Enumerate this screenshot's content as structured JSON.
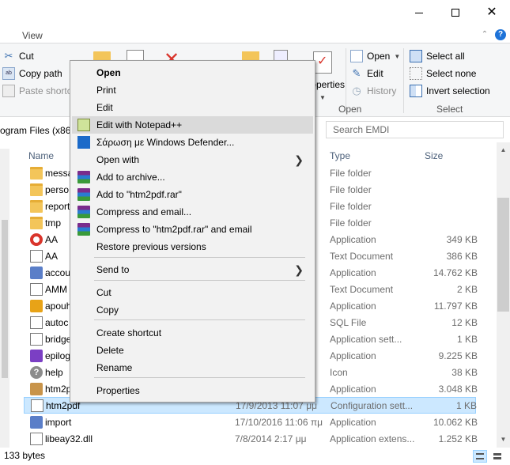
{
  "ribbon": {
    "tab_view": "View",
    "clipboard": {
      "cut": "Cut",
      "copy_path": "Copy path",
      "paste_shortcut": "Paste shortcut"
    },
    "properties_label": "Properties",
    "open_group": {
      "open": "Open",
      "edit": "Edit",
      "history": "History",
      "label": "Open"
    },
    "select_group": {
      "select_all": "Select all",
      "select_none": "Select none",
      "invert_selection": "Invert selection",
      "label": "Select"
    }
  },
  "address": {
    "path": "ogram Files (x86)",
    "search_placeholder": "Search EMDI"
  },
  "columns": {
    "name": "Name",
    "type": "Type",
    "size": "Size"
  },
  "files": [
    {
      "name": "messa",
      "date": "",
      "type": "File folder",
      "size": "",
      "icon": "folder-icon"
    },
    {
      "name": "perso",
      "date": "",
      "type": "File folder",
      "size": "",
      "icon": "folder-icon"
    },
    {
      "name": "report",
      "date": "",
      "type": "File folder",
      "size": "",
      "icon": "folder-icon"
    },
    {
      "name": "tmp",
      "date": "",
      "type": "File folder",
      "size": "",
      "icon": "folder-icon"
    },
    {
      "name": "AA",
      "date": "",
      "type": "Application",
      "size": "349 KB",
      "icon": "lifebuoy-icon"
    },
    {
      "name": "AA",
      "date": "",
      "type": "Text Document",
      "size": "386 KB",
      "icon": "text-document-icon"
    },
    {
      "name": "accou",
      "date": "",
      "type": "Application",
      "size": "14.762 KB",
      "icon": "application-icon"
    },
    {
      "name": "AMM",
      "date": "",
      "type": "Text Document",
      "size": "2 KB",
      "icon": "text-document-icon"
    },
    {
      "name": "apouh",
      "date": "",
      "type": "Application",
      "size": "11.797 KB",
      "icon": "gold-app-icon"
    },
    {
      "name": "autoc",
      "date": "",
      "type": "SQL File",
      "size": "12 KB",
      "icon": "sql-file-icon"
    },
    {
      "name": "bridge",
      "date": "",
      "type": "Application sett...",
      "size": "1 KB",
      "icon": "config-file-icon"
    },
    {
      "name": "epilog",
      "date": "",
      "type": "Application",
      "size": "9.225 KB",
      "icon": "purple-app-icon"
    },
    {
      "name": "help",
      "date": "",
      "type": "Icon",
      "size": "38 KB",
      "icon": "help-icon"
    },
    {
      "name": "htm2p",
      "date": "",
      "type": "Application",
      "size": "3.048 KB",
      "icon": "box-app-icon"
    },
    {
      "name": "htm2pdf",
      "date": "17/9/2013 11:07 μμ",
      "type": "Configuration sett...",
      "size": "1 KB",
      "icon": "config-file-icon",
      "selected": true
    },
    {
      "name": "import",
      "date": "17/10/2016 11:06 πμ",
      "type": "Application",
      "size": "10.062 KB",
      "icon": "application-icon"
    },
    {
      "name": "libeay32.dll",
      "date": "7/8/2014 2:17 μμ",
      "type": "Application extens...",
      "size": "1.252 KB",
      "icon": "dll-file-icon"
    }
  ],
  "status": {
    "item_size": "133 bytes"
  },
  "context_menu": {
    "items": [
      {
        "label": "Open",
        "bold": true
      },
      {
        "label": "Print"
      },
      {
        "label": "Edit"
      },
      {
        "label": "Edit with Notepad++",
        "icon": "notepad-plus-plus-icon",
        "hover": true
      },
      {
        "label": "Σάρωση με Windows Defender...",
        "icon": "windows-defender-icon"
      },
      {
        "label": "Open with",
        "submenu": true
      },
      {
        "label": "Add to archive...",
        "icon": "winrar-icon"
      },
      {
        "label": "Add to \"htm2pdf.rar\"",
        "icon": "winrar-icon"
      },
      {
        "label": "Compress and email...",
        "icon": "winrar-icon"
      },
      {
        "label": "Compress to \"htm2pdf.rar\" and email",
        "icon": "winrar-icon"
      },
      {
        "label": "Restore previous versions"
      },
      {
        "label": "Send to",
        "submenu": true
      },
      {
        "label": "Cut"
      },
      {
        "label": "Copy"
      },
      {
        "label": "Create shortcut"
      },
      {
        "label": "Delete"
      },
      {
        "label": "Rename"
      },
      {
        "label": "Properties"
      }
    ]
  },
  "colors": {
    "selection": "#cce8ff",
    "menu_bg": "#f2f2f2",
    "hover": "#dadada"
  }
}
